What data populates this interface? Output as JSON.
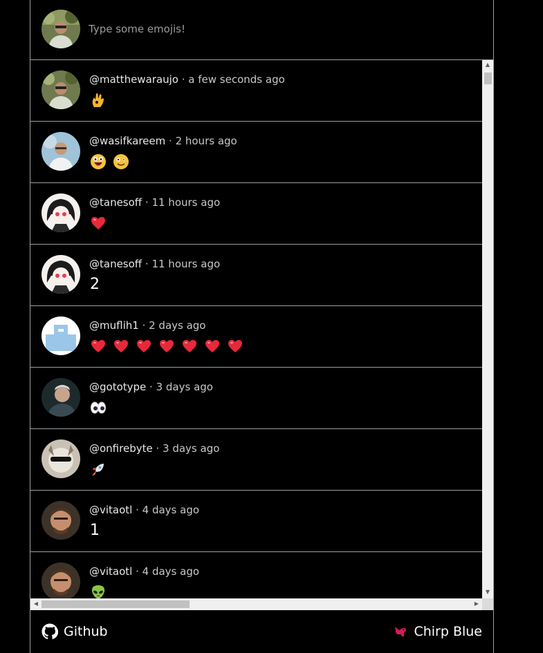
{
  "composer": {
    "placeholder": "Type some emojis!",
    "avatar": "user-avatar"
  },
  "posts": [
    {
      "handle": "@matthewaraujo",
      "time": "a few seconds ago",
      "text": "",
      "emojis": [
        "ok-hand"
      ],
      "avatar": "forest-photo"
    },
    {
      "handle": "@wasifkareem",
      "time": "2 hours ago",
      "text": "",
      "emojis": [
        "grinning-face",
        "zany-face"
      ],
      "avatar": "outdoor-photo"
    },
    {
      "handle": "@tanesoff",
      "time": "11 hours ago",
      "text": "",
      "emojis": [
        "heart"
      ],
      "avatar": "anime-drawing"
    },
    {
      "handle": "@tanesoff",
      "time": "11 hours ago",
      "text": "2",
      "emojis": [],
      "avatar": "anime-drawing"
    },
    {
      "handle": "@muflih1",
      "time": "2 days ago",
      "text": "",
      "emojis": [
        "heart",
        "heart",
        "heart",
        "heart",
        "heart",
        "heart",
        "heart"
      ],
      "avatar": "default-avatar"
    },
    {
      "handle": "@gototype",
      "time": "3 days ago",
      "text": "",
      "emojis": [
        "eyes"
      ],
      "avatar": "portrait-photo"
    },
    {
      "handle": "@onfirebyte",
      "time": "3 days ago",
      "text": "",
      "emojis": [
        "rocket"
      ],
      "avatar": "cat-sunglasses-photo"
    },
    {
      "handle": "@vitaotl",
      "time": "4 days ago",
      "text": "1",
      "emojis": [],
      "avatar": "man-photo"
    },
    {
      "handle": "@vitaotl",
      "time": "4 days ago",
      "text": "",
      "emojis": [
        "alien"
      ],
      "avatar": "man-photo"
    }
  ],
  "footer": {
    "github_label": "Github",
    "brand_label": "Chirp Blue"
  },
  "colors": {
    "background": "#000000",
    "border": "#9aa0a6",
    "heart": "#e8293b",
    "brand_bird": "#d81b5a"
  }
}
